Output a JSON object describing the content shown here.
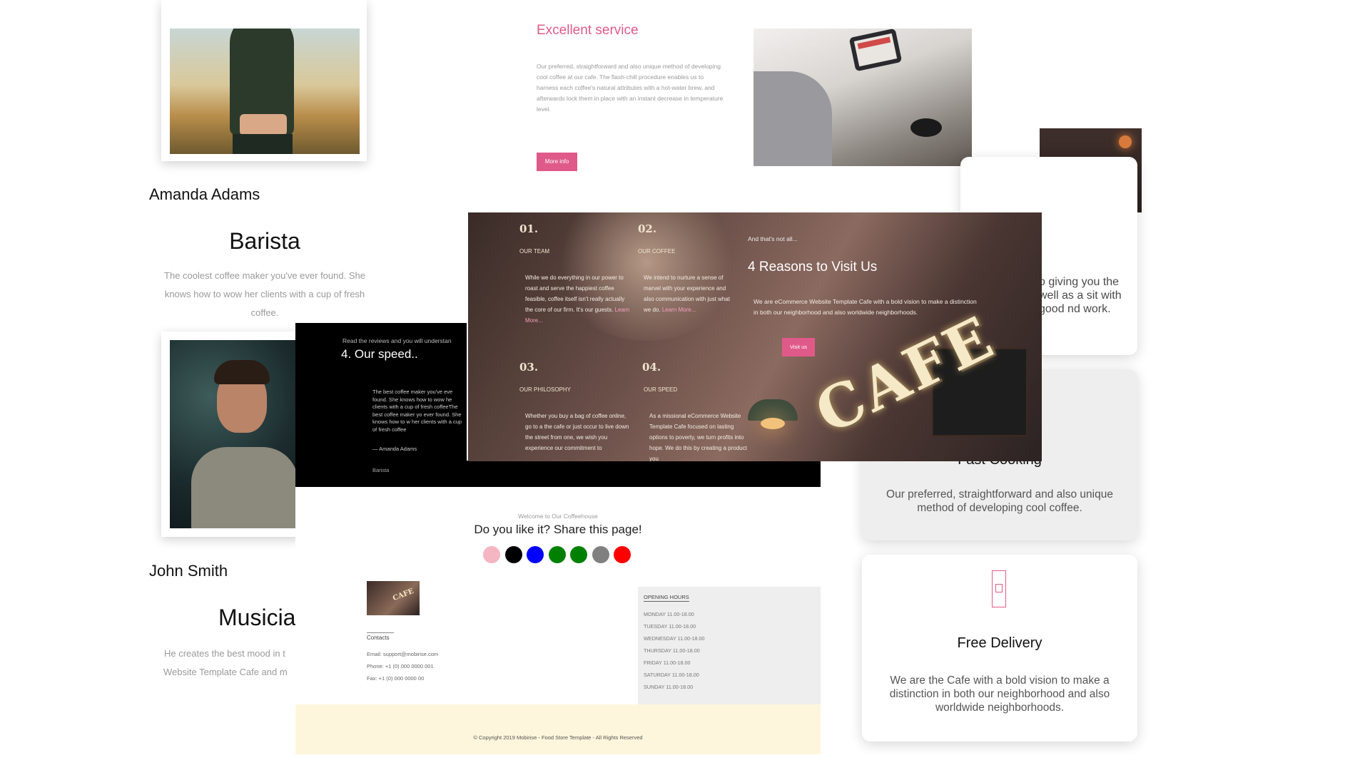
{
  "team": {
    "member1": {
      "name": "Amanda Adams",
      "role": "Barista",
      "desc": "The coolest coffee maker you've ever found. She knows how to wow her clients with a cup of fresh coffee."
    },
    "member2": {
      "name": "John Smith",
      "role": "Musicia",
      "desc_line1": "He creates the best mood in t",
      "desc_line2": "Website Template Cafe and m"
    }
  },
  "service": {
    "title": "Excellent service",
    "text": "Our preferred, straightforward and also unique method of developing cool coffee at our cafe. The flash-chill procedure enables us to harness each coffee's natural attributes with a hot-water brew, and afterwards lock them in place with an instant decrease in temperature level.",
    "button": "More info"
  },
  "features": {
    "top_text": "o giving you the well as a sit with good nd work.",
    "mid_title": "Fast Cooking",
    "mid_desc": "Our preferred, straightforward and also unique method of developing cool coffee.",
    "bot_title": "Free Delivery",
    "bot_desc": "We are the Cafe with a bold vision to make a distinction in both our neighborhood and also worldwide neighborhoods."
  },
  "speed": {
    "kicker": "Read the reviews and you will understan",
    "title": "4. Our speed..",
    "quote": "The best coffee maker you've eve found. She knows how to wow he clients with a cup of fresh coffeeThe best coffee maker yo ever found. She knows how to w her clients with a cup of fresh coffee",
    "author": "— Amanda Adams",
    "role": "Barista"
  },
  "reasons": {
    "kicker": "And that's not all...",
    "title": "4 Reasons to Visit Us",
    "desc": "We are eCommerce Website Template Cafe with a bold vision to make a distinction in both our neighborhood and also worldwide neighborhoods.",
    "button": "Visit us",
    "items": [
      {
        "num": "01.",
        "label": "Our Team",
        "text": "While we do everything in our power to roast and serve the happiest coffee feasible, coffee itself isn't really actually the core of our firm. It's our guests.",
        "link": "Learn More..."
      },
      {
        "num": "02.",
        "label": "Our Coffee",
        "text": "We intend to nurture a sense of marvel with your experience and also communication with just what we do.",
        "link": "Learn More..."
      },
      {
        "num": "03.",
        "label": "Our Philosophy",
        "text": "Whether you buy a bag of coffee online, go to a the cafe or just occur to live down the street from one, we wish you experience our commitment to",
        "link": ""
      },
      {
        "num": "04.",
        "label": "Our Speed",
        "text": "As a missional eCommerce Website Template Cafe focused on lasting options to poverty, we turn profits into hope. We do this by creating a product you",
        "link": ""
      }
    ]
  },
  "share": {
    "kicker": "Welcome to Our Coffeehouse",
    "title": "Do you like it? Share this page!",
    "dots": [
      {
        "name": "share-dot-pink",
        "color": "#f4b6c2"
      },
      {
        "name": "share-dot-black",
        "color": "#000000"
      },
      {
        "name": "share-dot-blue",
        "color": "#0000ff"
      },
      {
        "name": "share-dot-green-1",
        "color": "#008000"
      },
      {
        "name": "share-dot-green-2",
        "color": "#008000"
      },
      {
        "name": "share-dot-gray",
        "color": "#808080"
      },
      {
        "name": "share-dot-red",
        "color": "#ff0000"
      }
    ]
  },
  "footer": {
    "thumb_text": "CAFE",
    "contacts_head": "Contacts",
    "email": "Email: support@mobirise.com",
    "phone": "Phone: +1 (0) 000 0000 001",
    "fax": "Fax: +1 (0) 000 0000 00",
    "hours_head": "Opening Hours",
    "hours": [
      "Monday 11.00-18.00",
      "Tuesday 11.00-18.00",
      "Wednesday 11.00-18.00",
      "Thursday 11.00-18.00",
      "Friday 11.00-18.00",
      "Saturday 11.00-18.00",
      "Sunday 11.00-18.00"
    ],
    "copyright": "© Copyright 2019 Mobirise - Food Store Template - All Rights Reserved"
  }
}
